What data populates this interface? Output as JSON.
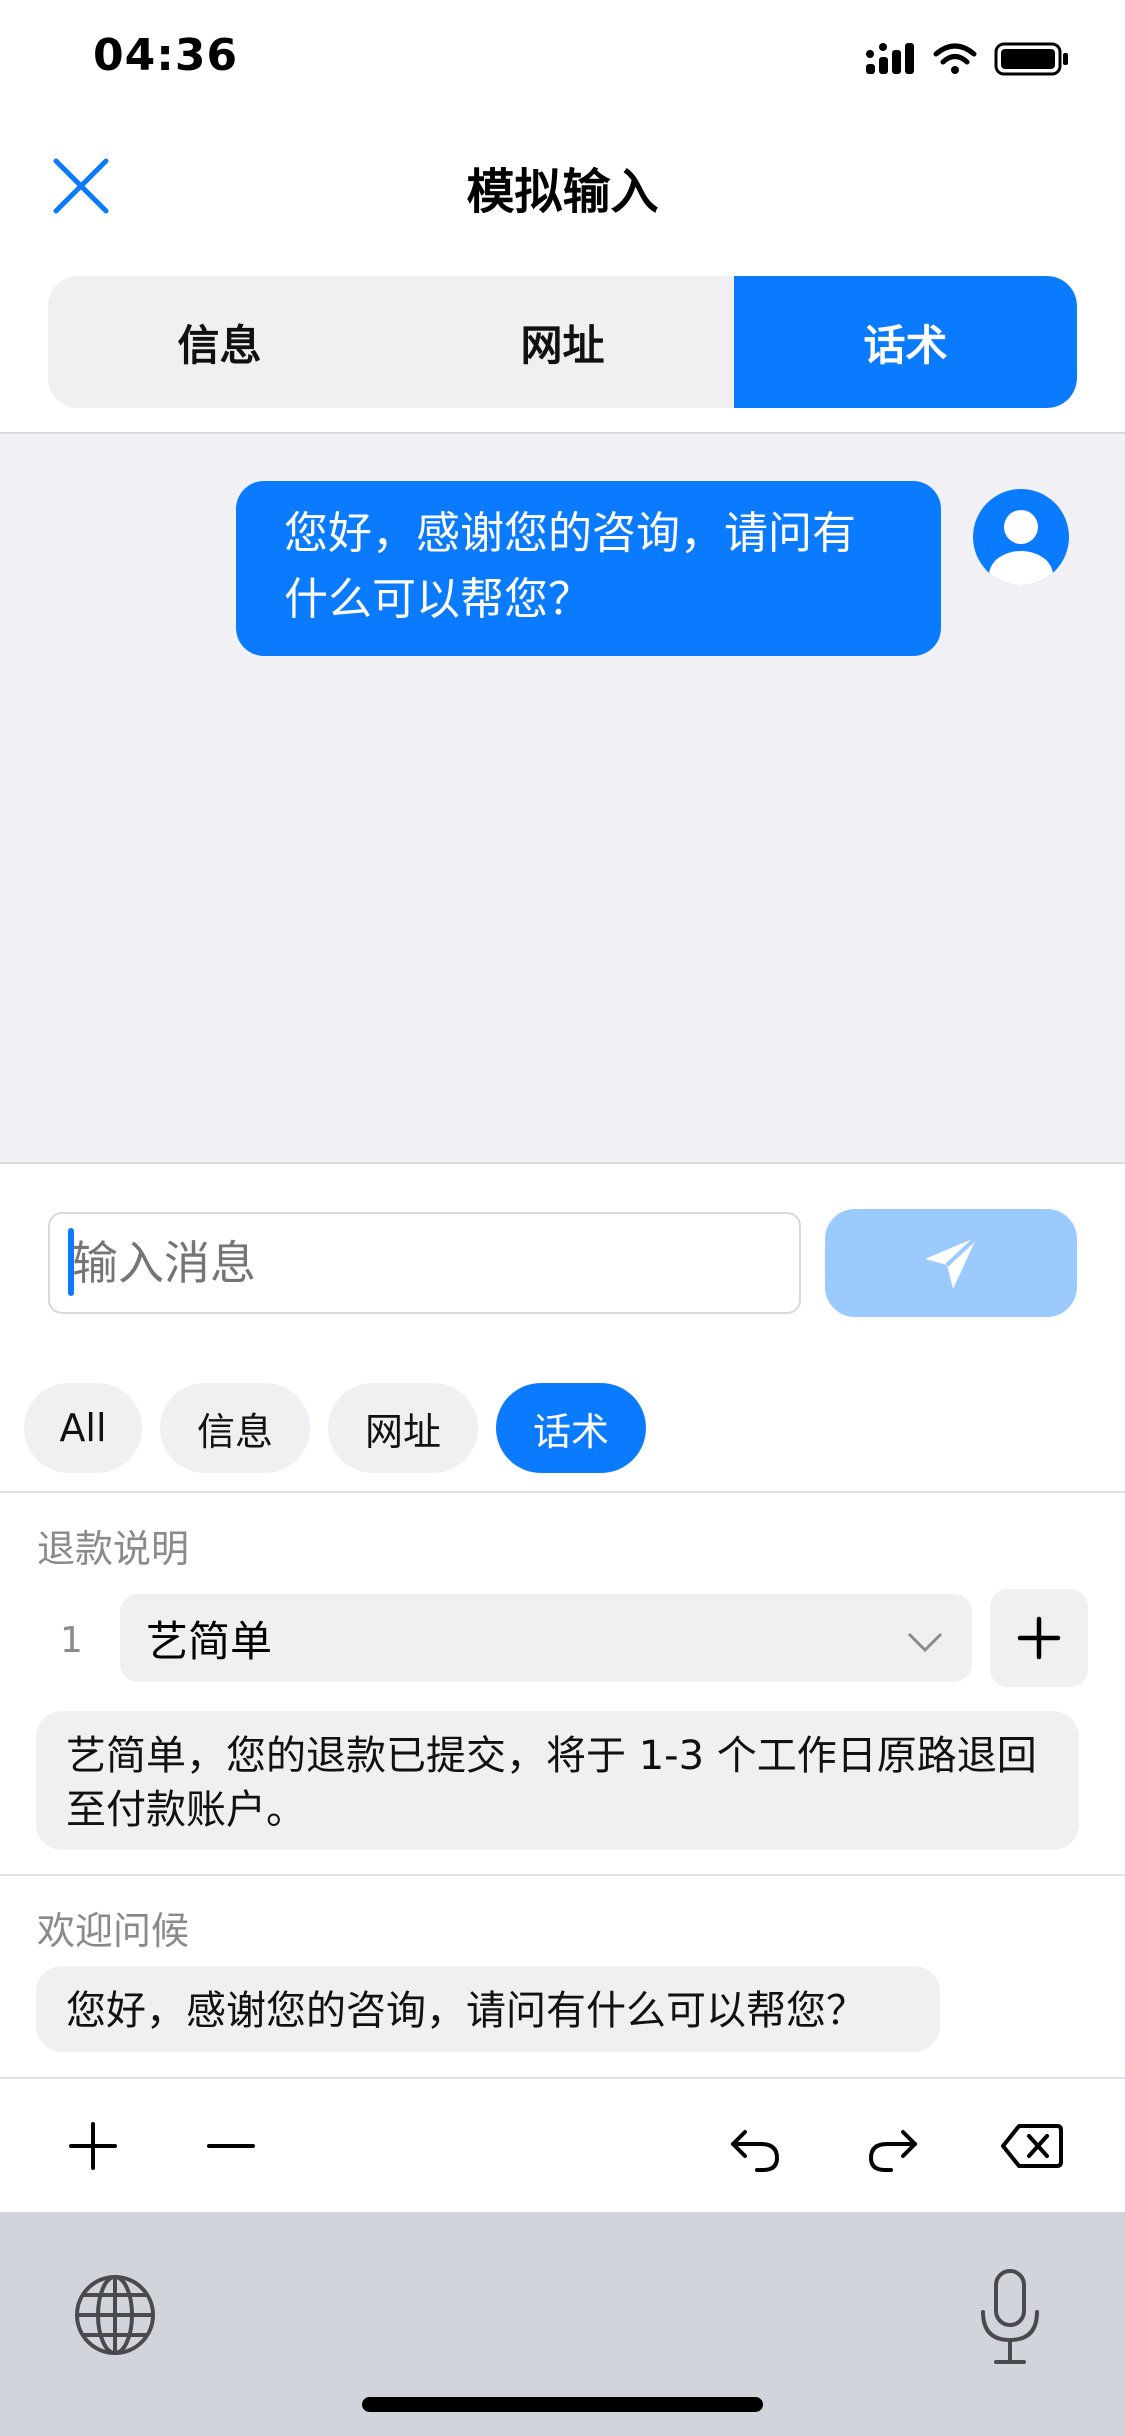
{
  "status_bar": {
    "time": "04:36"
  },
  "nav": {
    "title": "模拟输入"
  },
  "segments": [
    {
      "label": "信息",
      "active": false
    },
    {
      "label": "网址",
      "active": false
    },
    {
      "label": "话术",
      "active": true
    }
  ],
  "chat": {
    "messages": [
      {
        "text": "您好，感谢您的咨询，请问有什么可以帮您？",
        "from": "user"
      }
    ]
  },
  "composer": {
    "placeholder": "输入消息",
    "value": ""
  },
  "filters": [
    {
      "label": "All",
      "active": false
    },
    {
      "label": "信息",
      "active": false
    },
    {
      "label": "网址",
      "active": false
    },
    {
      "label": "话术",
      "active": true
    }
  ],
  "sections": [
    {
      "title": "退款说明",
      "param_index": "1",
      "param_value": "艺简单",
      "preview": "艺简单，您的退款已提交，将于 1-3 个工作日原路退回至付款账户。"
    },
    {
      "title": "欢迎问候",
      "preview": "您好，感谢您的咨询，请问有什么可以帮您？"
    }
  ],
  "colors": {
    "accent": "#0a7bff",
    "send_disabled": "#9bcaff",
    "surface": "#f0f0f3",
    "keyboard": "#d1d4da"
  },
  "icons": [
    "close-icon",
    "send-icon",
    "chevron-down-icon",
    "plus-icon",
    "minus-icon",
    "undo-icon",
    "redo-icon",
    "backspace-icon",
    "globe-icon",
    "microphone-icon",
    "avatar-icon"
  ]
}
